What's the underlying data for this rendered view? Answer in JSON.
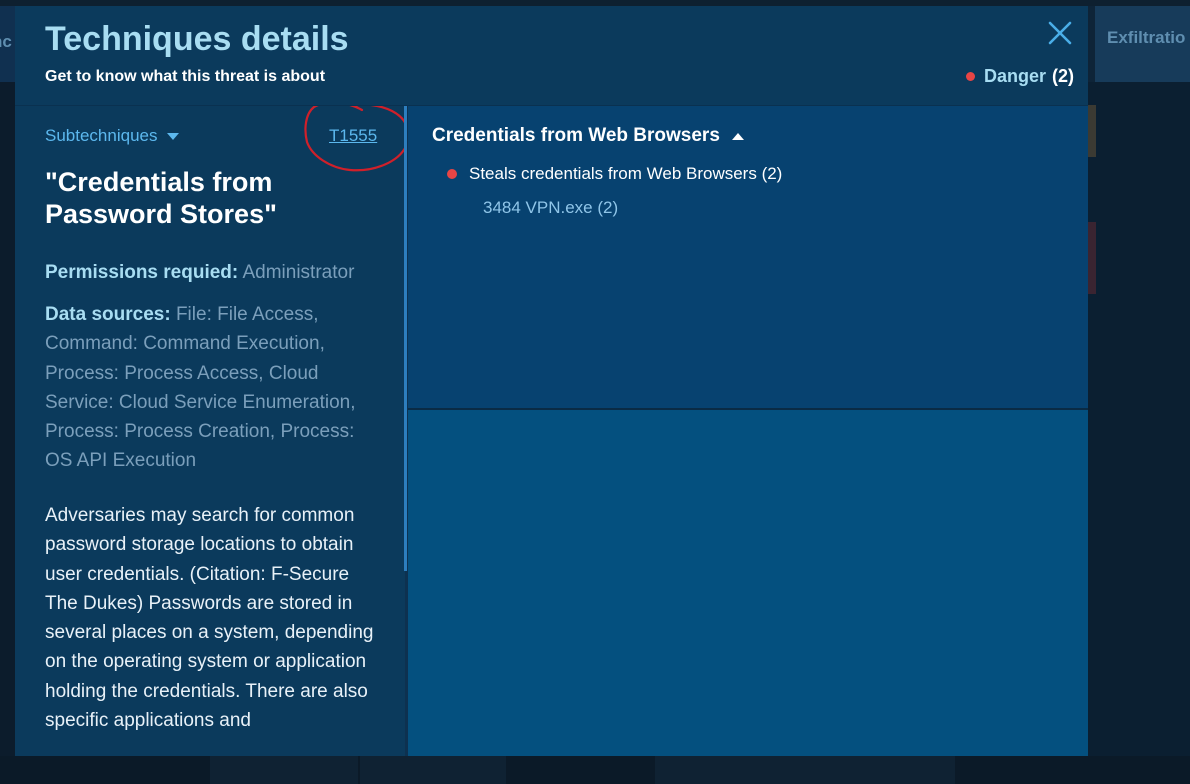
{
  "background": {
    "left_tab_label": "nc",
    "right_tab_label": "Exfiltratio"
  },
  "modal": {
    "title": "Techniques details",
    "subtitle": "Get to know what this threat is about",
    "close_icon": "close-icon",
    "danger": {
      "label": "Danger",
      "paren_open": "(",
      "count": "2",
      "paren_close": ")",
      "color": "#e84545"
    }
  },
  "left": {
    "subtechniques_label": "Subtechniques",
    "technique_id": "T1555",
    "technique_name": "\"Credentials from Password Stores\"",
    "permissions_label": "Permissions requied:",
    "permissions_value": "Administrator",
    "data_sources_label": "Data sources:",
    "data_sources_value": "File: File Access, Command: Command Execution, Process: Process Access, Cloud Service: Cloud Service Enumeration, Process: Process Creation, Process: OS API Execution",
    "description": "Adversaries may search for common password storage locations to obtain user credentials. (Citation: F-Secure The Dukes) Passwords are stored in several places on a system, depending on the operating system or application holding the credentials. There are also specific applications and"
  },
  "right": {
    "group_title": "Credentials from Web Browsers",
    "behavior_label": "Steals credentials from Web Browsers (2)",
    "process_label": "3484 VPN.exe (2)"
  },
  "colors": {
    "accent": "#5cb8ee",
    "title": "#a8ddf2",
    "modal_bg": "#0b3a5c",
    "danger": "#e84545",
    "annotation": "#d0202a"
  }
}
